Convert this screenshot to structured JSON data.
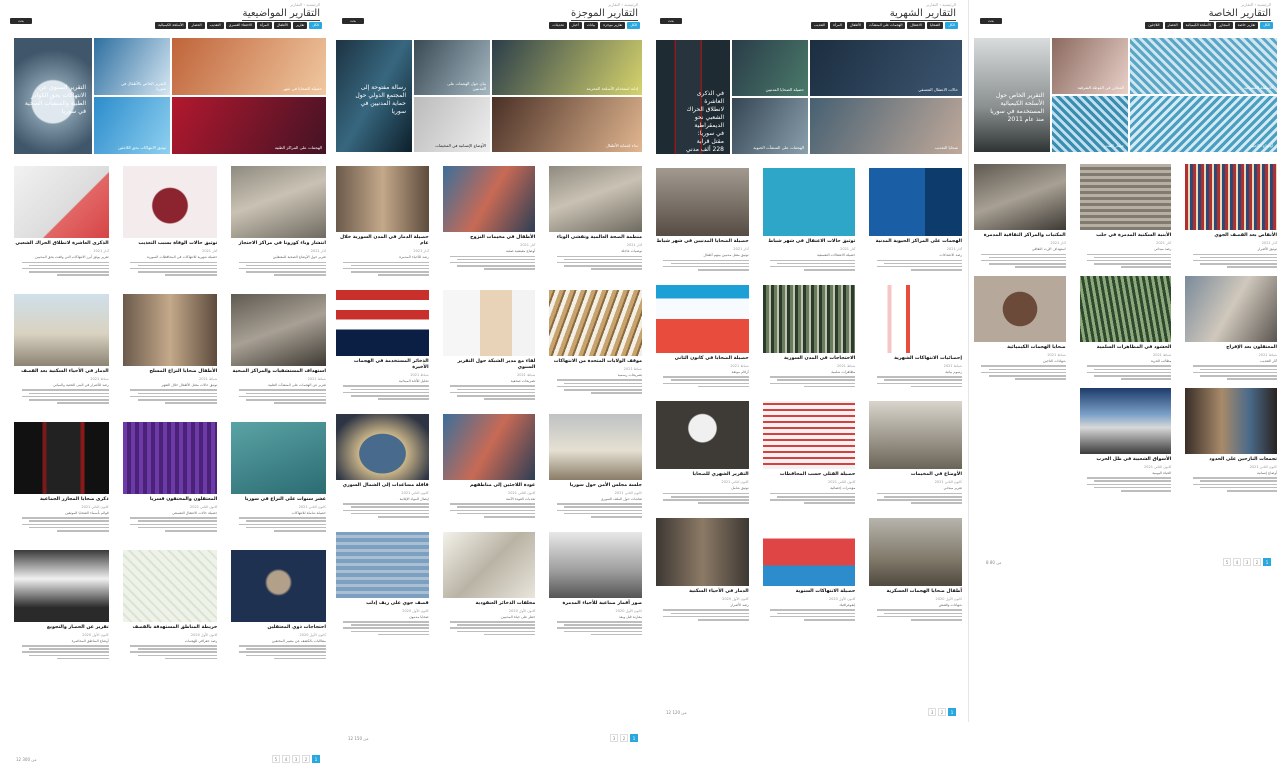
{
  "panels": [
    {
      "title": "التقارير المواضيعية",
      "crumb": "الرئيسية › التقارير",
      "top_button": "بحث",
      "filters": [
        "الكل",
        "تقارير",
        "الأطفال",
        "المرأة",
        "الاختفاء القسري",
        "التعذيب",
        "الحصار",
        "الأسلحة الكيميائية"
      ],
      "hero_tiles": [
        {
          "title": "التقرير الخاص بالأطفال في سوريا"
        },
        {
          "title": "حصيلة الضحايا في شهر"
        },
        {
          "title": "توثيق الانتهاكات بحق اللاجئين"
        },
        {
          "title": "الهجمات على المراكز الطبية"
        }
      ],
      "hero_big": "التقرير السنوي عن الانتهاكات بحق الكوادر الطبية والمنشآت الصحية في سوريا",
      "cards": [
        {
          "title": "الذكرى العاشرة لانطلاق الحراك الشعبي",
          "date": "آذار 2021",
          "excerpt": "تقرير يوثق أبرز الانتهاكات التي وقعت بحق المدنيين"
        },
        {
          "title": "توثيق حالات الوفاة بسبب التعذيب",
          "date": "آذار 2021",
          "excerpt": "حصيلة شهرية للانتهاكات في المحافظات السورية"
        },
        {
          "title": "انتشار وباء كورونا في مراكز الاحتجاز",
          "date": "آذار 2021",
          "excerpt": "تقرير حول الأوضاع الصحية للمعتقلين"
        },
        {
          "title": "الدمار في الأحياء السكنية بعد القصف",
          "date": "شباط 2021",
          "excerpt": "رصد للأضرار في البنى التحتية والمباني"
        },
        {
          "title": "الأطفال ضحايا النزاع المسلح",
          "date": "شباط 2021",
          "excerpt": "توثيق حالات مقتل الأطفال خلال الشهر"
        },
        {
          "title": "استهداف المستشفيات والمراكز الصحية",
          "date": "شباط 2021",
          "excerpt": "تقرير عن الهجمات على المنشآت الطبية"
        },
        {
          "title": "ذكرى ضحايا المجازر الجماعية",
          "date": "كانون الثاني 2021",
          "excerpt": "قوائم بأسماء الضحايا الموثقين"
        },
        {
          "title": "المعتقلون والمختفون قسريا",
          "date": "كانون الثاني 2021",
          "excerpt": "حصيلة حالات الاعتقال التعسفي"
        },
        {
          "title": "عشر سنوات على النزاع في سوريا",
          "date": "كانون الثاني 2021",
          "excerpt": "حصيلة شاملة للانتهاكات"
        },
        {
          "title": "تقرير عن الحصار والتجويع",
          "date": "كانون الأول 2020",
          "excerpt": "أوضاع المناطق المحاصرة"
        },
        {
          "title": "خريطة المناطق المستهدفة بالقصف",
          "date": "كانون الأول 2020",
          "excerpt": "رصد جغرافي للهجمات"
        },
        {
          "title": "احتجاجات ذوي المعتقلين",
          "date": "كانون الأول 2020",
          "excerpt": "مطالبات بالكشف عن مصير المختفين"
        }
      ],
      "count": "12 من 300",
      "pages": [
        "1",
        "2",
        "3",
        "4",
        "5"
      ]
    },
    {
      "title": "التقارير الموجزة",
      "crumb": "الرئيسية › التقارير",
      "top_button": "بحث",
      "filters": [
        "الكل",
        "تقارير موجزة",
        "بيانات",
        "أخبار",
        "تحديثات"
      ],
      "hero_tiles": [
        {
          "title": "بيان حول الهجمات على المدنيين"
        },
        {
          "title": "إدانة استخدام الأسلحة المحرمة"
        },
        {
          "title": "الأوضاع الإنسانية في المخيمات"
        },
        {
          "title": "نداء لحماية الأطفال"
        }
      ],
      "hero_big": "رسالة مفتوحة إلى المجتمع الدولي حول حماية المدنيين في سوريا",
      "cards": [
        {
          "title": "حصيلة الدمار في المدن السورية خلال عام",
          "date": "آذار 2021",
          "excerpt": "رصد للأحياء المدمرة"
        },
        {
          "title": "الأطفال في مخيمات النزوح",
          "date": "آذار 2021",
          "excerpt": "أوضاع معيشية صعبة"
        },
        {
          "title": "منظمة الصحة العالمية وتفشي الوباء",
          "date": "آذار 2021",
          "excerpt": "توصيات عاجلة"
        },
        {
          "title": "الذخائر المستخدمة في الهجمات الأخيرة",
          "date": "شباط 2021",
          "excerpt": "تحليل للأدلة الميدانية"
        },
        {
          "title": "لقاء مع مدير الشبكة حول التقرير السنوي",
          "date": "شباط 2021",
          "excerpt": "تصريحات صحفية"
        },
        {
          "title": "موقف الولايات المتحدة من الانتهاكات",
          "date": "شباط 2021",
          "excerpt": "تصريحات رسمية"
        },
        {
          "title": "قافلة مساعدات إلى الشمال السوري",
          "date": "كانون الثاني 2021",
          "excerpt": "إيصال المواد الإغاثية"
        },
        {
          "title": "عودة اللاجئين إلى مناطقهم",
          "date": "كانون الثاني 2021",
          "excerpt": "تحديات العودة الآمنة"
        },
        {
          "title": "جلسة مجلس الأمن حول سوريا",
          "date": "كانون الثاني 2021",
          "excerpt": "نقاشات حول الملف السوري"
        },
        {
          "title": "قصف جوي على ريف إدلب",
          "date": "كانون الأول 2020",
          "excerpt": "ضحايا مدنيون"
        },
        {
          "title": "مخلفات الذخائر العنقودية",
          "date": "كانون الأول 2020",
          "excerpt": "خطر على حياة المدنيين"
        },
        {
          "title": "صور أقمار صناعية للأحياء المدمرة",
          "date": "كانون الأول 2020",
          "excerpt": "مقارنة قبل وبعد"
        }
      ],
      "count": "12 من 150",
      "pages": [
        "1",
        "2",
        "3"
      ]
    },
    {
      "title": "التقارير الشهرية",
      "crumb": "الرئيسية › التقارير",
      "top_button": "بحث",
      "filters": [
        "الكل",
        "الضحايا",
        "الاعتقال",
        "الهجمات على المنشآت",
        "الأطفال",
        "المرأة",
        "التعذيب"
      ],
      "hero_tiles": [
        {
          "title": "حصيلة الضحايا المدنيين"
        },
        {
          "title": "حالات الاعتقال التعسفي"
        },
        {
          "title": "الهجمات على المنشآت الحيوية"
        },
        {
          "title": "ضحايا التعذيب"
        }
      ],
      "hero_big": "في الذكرى العاشرة لانطلاق الحراك الشعبي نحو الديمقراطية في سوريا: مقتل قرابة 228 ألف مدني",
      "cards": [
        {
          "title": "حصيلة الضحايا المدنيين في شهر شباط",
          "date": "آذار 2021",
          "excerpt": "توثيق مقتل مدنيين بينهم أطفال"
        },
        {
          "title": "توثيق حالات الاعتقال في شهر شباط",
          "date": "آذار 2021",
          "excerpt": "حصيلة الاعتقالات التعسفية"
        },
        {
          "title": "الهجمات على المراكز الحيوية المدنية",
          "date": "آذار 2021",
          "excerpt": "رصد الاعتداءات"
        },
        {
          "title": "حصيلة الضحايا في كانون الثاني",
          "date": "شباط 2021",
          "excerpt": "أرقام موثقة"
        },
        {
          "title": "الاحتجاجات في المدن السورية",
          "date": "شباط 2021",
          "excerpt": "مظاهرات سلمية"
        },
        {
          "title": "إحصائيات الانتهاكات الشهرية",
          "date": "شباط 2021",
          "excerpt": "رسوم بيانية"
        },
        {
          "title": "التقرير الشهري للضحايا",
          "date": "كانون الثاني 2021",
          "excerpt": "توثيق شامل"
        },
        {
          "title": "حصيلة القتلى حسب المحافظات",
          "date": "كانون الثاني 2021",
          "excerpt": "مؤشرات إحصائية"
        },
        {
          "title": "الأوضاع في المخيمات",
          "date": "كانون الثاني 2021",
          "excerpt": "تقرير ميداني"
        },
        {
          "title": "الدمار في الأحياء السكنية",
          "date": "كانون الأول 2020",
          "excerpt": "رصد الأضرار"
        },
        {
          "title": "حصيلة الانتهاكات السنوية",
          "date": "كانون الأول 2020",
          "excerpt": "إنفوغرافيك"
        },
        {
          "title": "أطفال ضحايا الهجمات العسكرية",
          "date": "كانون الأول 2020",
          "excerpt": "شهادات وقصص"
        }
      ],
      "count": "12 من 120",
      "pages": [
        "1",
        "2",
        "3"
      ]
    },
    {
      "title": "التقارير الخاصة",
      "crumb": "الرئيسية › التقارير",
      "top_button": "بحث",
      "filters": [
        "الكل",
        "تقارير خاصة",
        "المجازر",
        "الأسلحة الكيميائية",
        "الحصار",
        "اللاجئين"
      ],
      "hero_tiles": [
        {
          "title": "المجازر في الغوطة الشرقية"
        },
        {
          "title": "الأسلحة الكيميائية"
        },
        {
          "title": "حصار المدن"
        },
        {
          "title": "أوضاع اللاجئين"
        }
      ],
      "hero_big": "التقرير الخاص حول الأسلحة الكيميائية المستخدمة في سوريا منذ عام 2011",
      "cards": [
        {
          "title": "المكتبات والمراكز الثقافية المدمرة",
          "date": "آذار 2021",
          "excerpt": "استهداف الإرث الثقافي"
        },
        {
          "title": "الأبنية السكنية المدمرة في حلب",
          "date": "آذار 2021",
          "excerpt": "رصد ميداني"
        },
        {
          "title": "الأنقاض بعد القصف الجوي",
          "date": "آذار 2021",
          "excerpt": "توثيق الأضرار"
        },
        {
          "title": "ضحايا الهجمات الكيميائية",
          "date": "شباط 2021",
          "excerpt": "شهادات الناجين"
        },
        {
          "title": "الحشود في المظاهرات السلمية",
          "date": "شباط 2021",
          "excerpt": "مطالب الحرية"
        },
        {
          "title": "المعتقلون بعد الإفراج",
          "date": "شباط 2021",
          "excerpt": "آثار التعذيب"
        },
        {
          "title": "الأسواق الشعبية في ظل الحرب",
          "date": "كانون الثاني 2021",
          "excerpt": "الحياة اليومية"
        },
        {
          "title": "تجمعات النازحين على الحدود",
          "date": "كانون الثاني 2021",
          "excerpt": "أوضاع إنسانية"
        }
      ],
      "count": "8 من 80",
      "pages": [
        "1",
        "2",
        "3",
        "4",
        "5"
      ]
    }
  ]
}
